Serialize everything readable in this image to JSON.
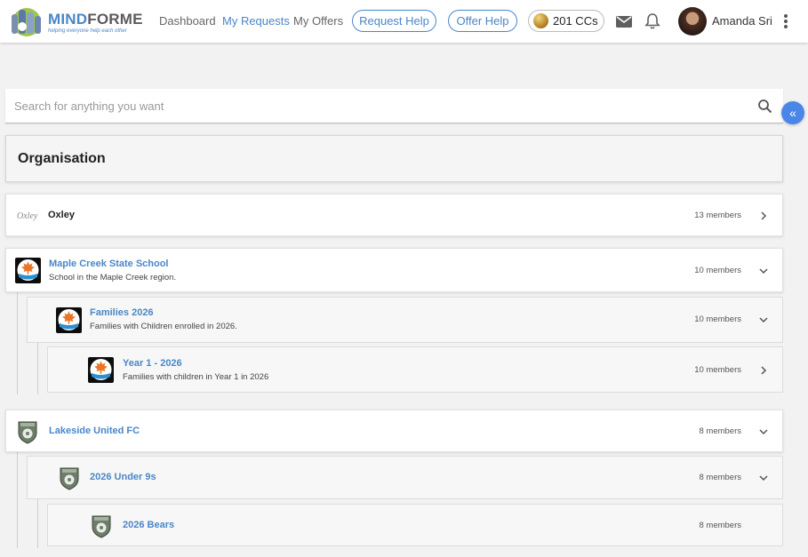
{
  "brand": {
    "name_part1": "MIND",
    "name_part2": "FORME",
    "tagline": "helping everyone help each other"
  },
  "nav": {
    "dashboard": "Dashboard",
    "my_requests": "My Requests",
    "my_offers": "My Offers",
    "request_help": "Request Help",
    "offer_help": "Offer Help",
    "credits": "201 CCs",
    "user_name": "Amanda Sri"
  },
  "search": {
    "placeholder": "Search for anything you want"
  },
  "section": {
    "title": "Organisation"
  },
  "orgs": [
    {
      "name": "Oxley",
      "description": "",
      "members": "13 members",
      "expanded": false,
      "logo_text": "Oxley"
    },
    {
      "name": "Maple Creek State School",
      "description": "School in the Maple Creek region.",
      "members": "10 members",
      "expanded": true,
      "children": [
        {
          "name": "Families 2026",
          "description": "Families with Children enrolled in 2026.",
          "members": "10 members",
          "expanded": true,
          "children": [
            {
              "name": "Year 1 - 2026",
              "description": "Families with children in Year 1 in 2026",
              "members": "10 members",
              "expanded": false
            }
          ]
        }
      ]
    },
    {
      "name": "Lakeside United FC",
      "description": "",
      "members": "8 members",
      "expanded": true,
      "children": [
        {
          "name": "2026 Under 9s",
          "description": "",
          "members": "8 members",
          "expanded": true,
          "children": [
            {
              "name": "2026 Bears",
              "description": "",
              "members": "8 members",
              "expanded": false
            }
          ]
        }
      ]
    }
  ],
  "colors": {
    "accent": "#4a86c8",
    "collapse_button": "#4a86e8",
    "maple_leaf": "#e8762a"
  },
  "icons": {
    "collapse": "double-chevron-left-icon",
    "search": "search-icon",
    "mail": "mail-icon",
    "bell": "bell-icon",
    "more": "more-vertical-icon"
  }
}
